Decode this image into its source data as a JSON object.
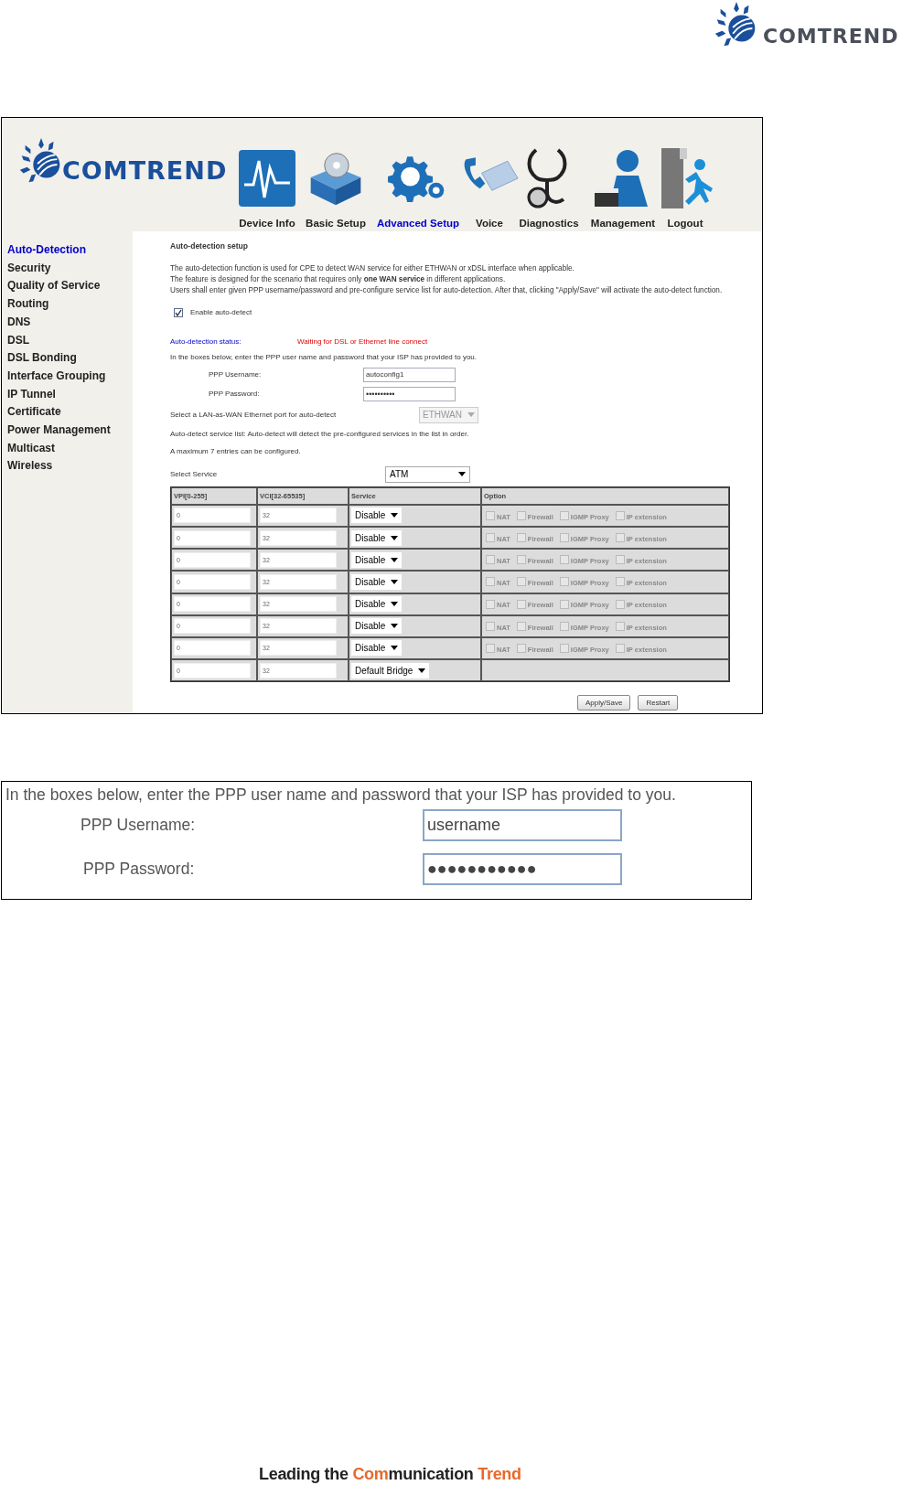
{
  "brand_logo": {
    "text": "COMTREND"
  },
  "router_ui": {
    "logo": {
      "text": "COMTREND"
    },
    "nav": [
      {
        "label": "Device Info",
        "selected": false
      },
      {
        "label": "Basic Setup",
        "selected": false
      },
      {
        "label": "Advanced Setup",
        "selected": true
      },
      {
        "label": "Voice",
        "selected": false
      },
      {
        "label": "Diagnostics",
        "selected": false
      },
      {
        "label": "Management",
        "selected": false
      },
      {
        "label": "Logout",
        "selected": false
      }
    ],
    "sidebar": [
      {
        "label": "Auto-Detection",
        "selected": true
      },
      {
        "label": "Security",
        "selected": false
      },
      {
        "label": "Quality of Service",
        "selected": false
      },
      {
        "label": "Routing",
        "selected": false
      },
      {
        "label": "DNS",
        "selected": false
      },
      {
        "label": "DSL",
        "selected": false
      },
      {
        "label": "DSL Bonding",
        "selected": false
      },
      {
        "label": "Interface Grouping",
        "selected": false
      },
      {
        "label": "IP Tunnel",
        "selected": false
      },
      {
        "label": "Certificate",
        "selected": false
      },
      {
        "label": "Power Management",
        "selected": false
      },
      {
        "label": "Multicast",
        "selected": false
      },
      {
        "label": "Wireless",
        "selected": false
      }
    ],
    "heading": "Auto-detection setup",
    "description": [
      "The auto-detection function is used for CPE to detect WAN service for either ETHWAN or xDSL interface when applicable.",
      "The feature is designed for the scenario that requires only **one WAN service** in different applications.",
      "Users shall enter given PPP username/password and pre-configure service list for auto-detection. After that, clicking \"Apply/Save\" will activate the auto-detect function."
    ],
    "enable": {
      "label": "Enable auto-detect",
      "checked": true
    },
    "status": {
      "label": "Auto-detection status:",
      "value": "Waiting for DSL or Ethernet line connect"
    },
    "ppp_intro": "In the boxes below, enter the PPP user name and password that your ISP has provided to you.",
    "ppp_username": {
      "label": "PPP Username:",
      "value": "autoconfig1"
    },
    "ppp_password": {
      "label": "PPP Password:",
      "value": "••••••••••"
    },
    "lan_port": {
      "label": "Select a LAN-as-WAN Ethernet port for auto-detect",
      "value": "ETHWAN",
      "disabled": true
    },
    "service_list_note": "Auto-detect service list: Auto-detect will detect the pre-configured services in the list in order.",
    "max_note": "A maximum 7 entries can be configured.",
    "select_service": {
      "label": "Select Service",
      "value": "ATM"
    },
    "table": {
      "columns": [
        "VPI[0-255]",
        "VCI[32-65535]",
        "Service",
        "Option"
      ],
      "rows": [
        {
          "vpi": "0",
          "vci": "32",
          "service": "Disable",
          "options": [
            {
              "label": "NAT",
              "checked": false
            },
            {
              "label": "Firewall",
              "checked": false
            },
            {
              "label": "IGMP Proxy",
              "checked": false
            },
            {
              "label": "IP extension",
              "checked": false
            }
          ]
        },
        {
          "vpi": "0",
          "vci": "32",
          "service": "Disable",
          "options": [
            {
              "label": "NAT",
              "checked": false
            },
            {
              "label": "Firewall",
              "checked": false
            },
            {
              "label": "IGMP Proxy",
              "checked": false
            },
            {
              "label": "IP extension",
              "checked": false
            }
          ]
        },
        {
          "vpi": "0",
          "vci": "32",
          "service": "Disable",
          "options": [
            {
              "label": "NAT",
              "checked": false
            },
            {
              "label": "Firewall",
              "checked": false
            },
            {
              "label": "IGMP Proxy",
              "checked": false
            },
            {
              "label": "IP extension",
              "checked": false
            }
          ]
        },
        {
          "vpi": "0",
          "vci": "32",
          "service": "Disable",
          "options": [
            {
              "label": "NAT",
              "checked": false
            },
            {
              "label": "Firewall",
              "checked": false
            },
            {
              "label": "IGMP Proxy",
              "checked": false
            },
            {
              "label": "IP extension",
              "checked": false
            }
          ]
        },
        {
          "vpi": "0",
          "vci": "32",
          "service": "Disable",
          "options": [
            {
              "label": "NAT",
              "checked": false
            },
            {
              "label": "Firewall",
              "checked": false
            },
            {
              "label": "IGMP Proxy",
              "checked": false
            },
            {
              "label": "IP extension",
              "checked": false
            }
          ]
        },
        {
          "vpi": "0",
          "vci": "32",
          "service": "Disable",
          "options": [
            {
              "label": "NAT",
              "checked": false
            },
            {
              "label": "Firewall",
              "checked": false
            },
            {
              "label": "IGMP Proxy",
              "checked": false
            },
            {
              "label": "IP extension",
              "checked": false
            }
          ]
        },
        {
          "vpi": "0",
          "vci": "32",
          "service": "Disable",
          "options": [
            {
              "label": "NAT",
              "checked": false
            },
            {
              "label": "Firewall",
              "checked": false
            },
            {
              "label": "IGMP Proxy",
              "checked": false
            },
            {
              "label": "IP extension",
              "checked": false
            }
          ]
        },
        {
          "vpi": "0",
          "vci": "32",
          "service": "Default Bridge"
        }
      ]
    },
    "buttons": [
      "Apply/Save",
      "Restart"
    ]
  },
  "zoom_panel": {
    "intro": "In the boxes below, enter the PPP user name and password that your ISP has provided to you.",
    "username": {
      "label": "PPP Username:",
      "value": "username"
    },
    "password": {
      "label": "PPP Password:",
      "value": "●●●●●●●●●●●"
    }
  },
  "footer": [
    {
      "text": "Leading the ",
      "accent": false
    },
    {
      "text": "Com",
      "accent": true
    },
    {
      "text": "munication ",
      "accent": false
    },
    {
      "text": "Trend",
      "accent": true
    }
  ]
}
